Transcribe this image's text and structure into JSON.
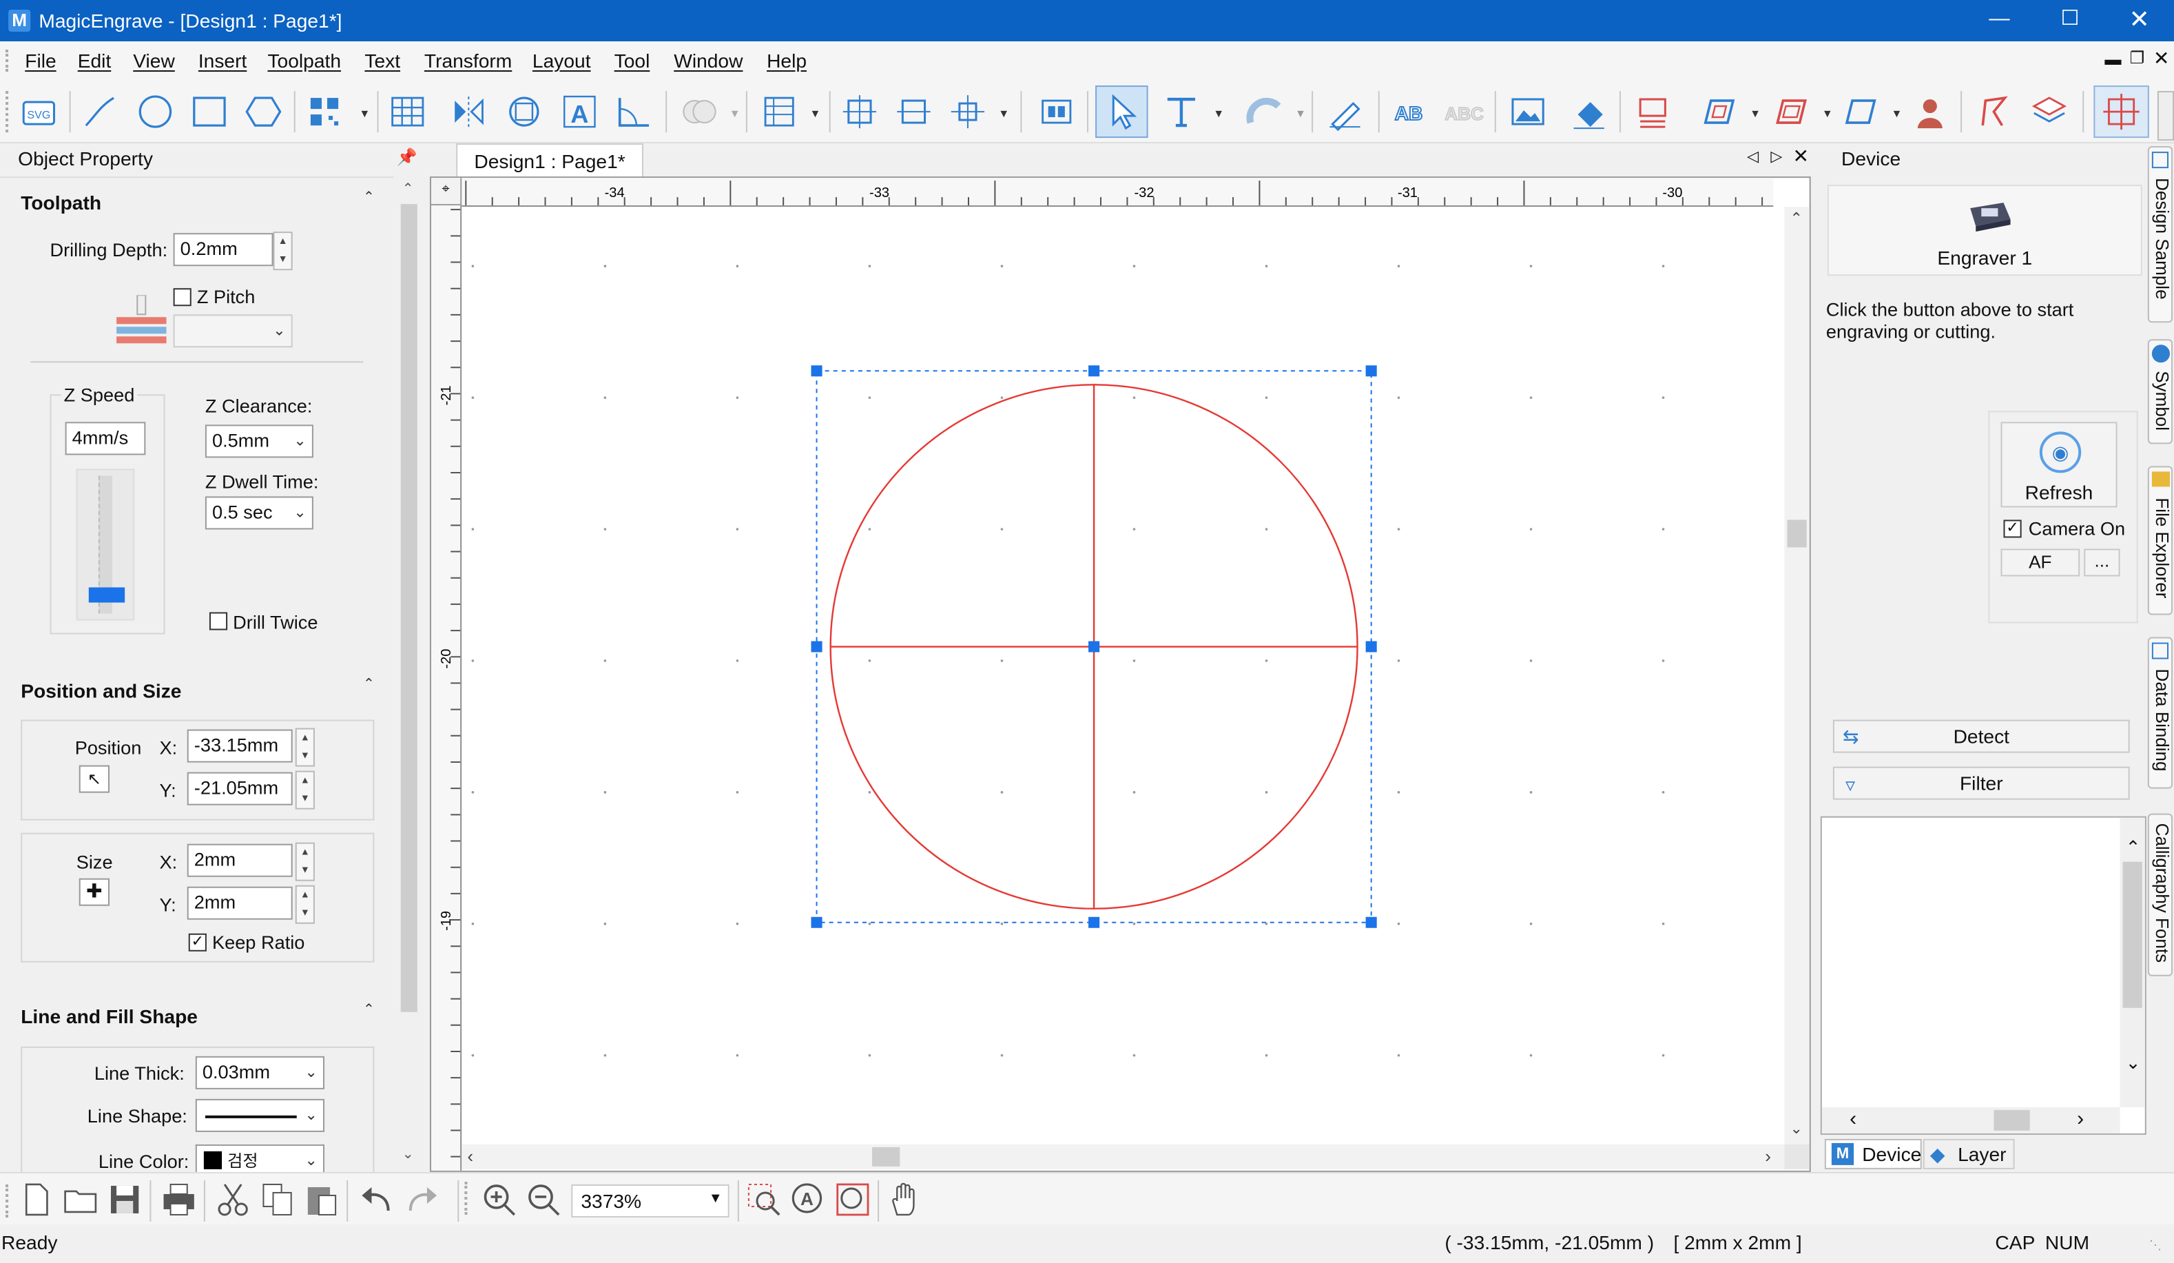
{
  "app": {
    "title": "MagicEngrave - [Design1 : Page1*]",
    "logo_letter": "M"
  },
  "menu": [
    "File",
    "Edit",
    "View",
    "Insert",
    "Toolpath",
    "Text",
    "Transform",
    "Layout",
    "Tool",
    "Window",
    "Help"
  ],
  "toolbar": {
    "svg_label": "SVG"
  },
  "left_panel": {
    "title": "Object Property",
    "toolpath": {
      "title": "Toolpath",
      "drilling_depth_label": "Drilling Depth:",
      "drilling_depth_value": "0.2mm",
      "z_pitch_label": "Z Pitch",
      "z_speed_label": "Z Speed",
      "z_speed_value": "4mm/s",
      "z_speed_level": 0.1,
      "z_clearance_label": "Z Clearance:",
      "z_clearance_value": "0.5mm",
      "z_dwell_label": "Z Dwell Time:",
      "z_dwell_value": "0.5 sec",
      "drill_twice_label": "Drill Twice"
    },
    "position_size": {
      "title": "Position and Size",
      "position_label": "Position",
      "x_label": "X:",
      "y_label": "Y:",
      "pos_x": "-33.15mm",
      "pos_y": "-21.05mm",
      "size_label": "Size",
      "size_x": "2mm",
      "size_y": "2mm",
      "keep_ratio_label": "Keep Ratio"
    },
    "line_fill": {
      "title": "Line and Fill Shape",
      "line_thick_label": "Line Thick:",
      "line_thick_value": "0.03mm",
      "line_shape_label": "Line Shape:",
      "line_color_label": "Line Color:",
      "line_color_value": "검정",
      "line_color_hex": "#000000"
    }
  },
  "document": {
    "tab": "Design1 : Page1*",
    "ruler_top": [
      "-34",
      "-33",
      "-32",
      "-31",
      "-30"
    ],
    "ruler_left": [
      "-21",
      "-20",
      "-19"
    ]
  },
  "device_panel": {
    "title": "Device",
    "engraver": "Engraver 1",
    "hint": "Click the button above to start engraving or cutting.",
    "refresh": "Refresh",
    "camera_on": "Camera On",
    "af": "AF",
    "more": "...",
    "detect": "Detect",
    "filter": "Filter",
    "tab_device": "Device",
    "tab_layer": "Layer"
  },
  "side_tabs": [
    "Design Sample",
    "Symbol",
    "File Explorer",
    "Data Binding",
    "Calligraphy Fonts"
  ],
  "bottom": {
    "zoom": "3373%"
  },
  "status": {
    "ready": "Ready",
    "coords": "( -33.15mm, -21.05mm )",
    "size": "[ 2mm x 2mm ]",
    "cap": "CAP",
    "num": "NUM"
  },
  "colors": {
    "titlebar": "#0b62c2",
    "selection": "#1a73e8",
    "shape": "#e53935"
  }
}
